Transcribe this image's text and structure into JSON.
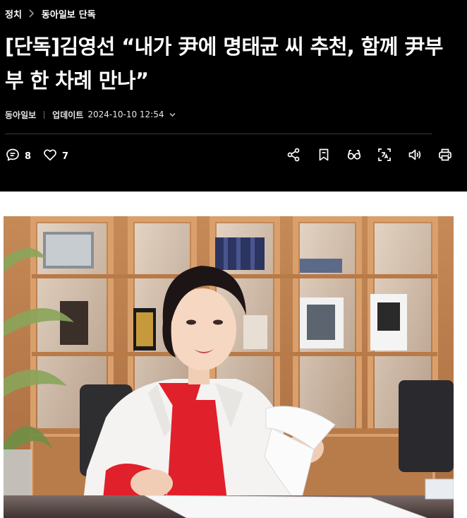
{
  "breadcrumb": {
    "section": "정치",
    "source": "동아일보",
    "tag": "단독"
  },
  "article": {
    "title": "[단독]김영선 “내가 尹에 명태균 씨 추천, 함께 尹부부 한 차례 만나”",
    "source": "동아일보",
    "update_label": "업데이트",
    "updated_at": "2024-10-10 12:54"
  },
  "toolbar": {
    "comment_count": "8",
    "like_count": "7",
    "icons": [
      "comment-icon",
      "heart-icon",
      "share-icon",
      "bookmark-icon",
      "reading-glasses-icon",
      "translate-icon",
      "speaker-icon",
      "print-icon"
    ]
  },
  "colors": {
    "header_bg": "#000000",
    "header_text": "#ffffff",
    "divider": "#3a3a3a",
    "shirt_red": "#e0202a",
    "cabinet_wood": "#c9895a"
  }
}
